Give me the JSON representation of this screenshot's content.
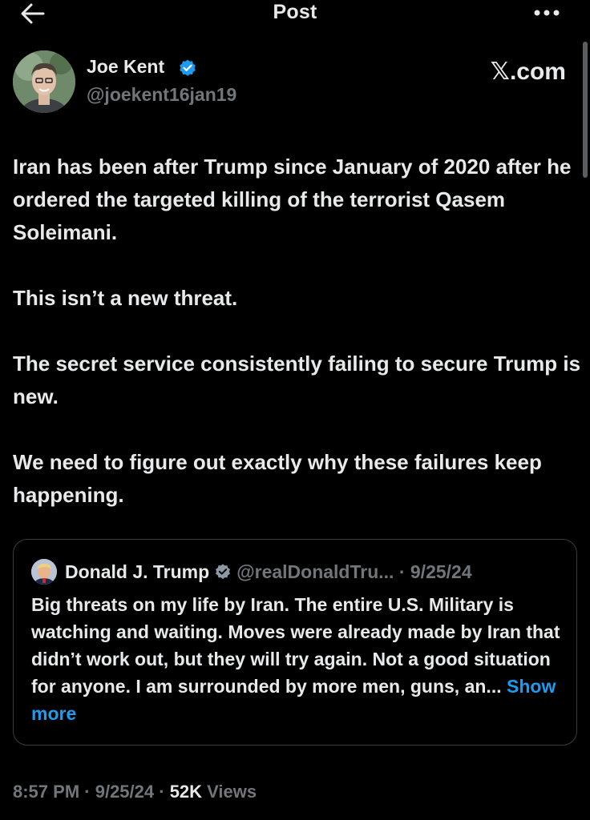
{
  "header": {
    "title": "Post",
    "back_icon": "arrow-left-icon",
    "more_icon": "more-horizontal-icon"
  },
  "author": {
    "name": "Joe Kent",
    "handle": "@joekent16jan19",
    "verified_icon": "verified-badge-icon",
    "source": "𝕏.com"
  },
  "post": {
    "paragraphs": [
      "Iran has been after Trump since January of 2020 after he ordered the targeted killing of the terrorist Qasem Soleimani.",
      "This isn’t a new threat.",
      "The secret service consistently failing to secure Trump is new.",
      "We need to figure out exactly why these failures keep happening."
    ]
  },
  "quote": {
    "name": "Donald J. Trump",
    "handle": "@realDonaldTru...",
    "separator": " · ",
    "date": "9/25/24",
    "text": "Big threats on my life by Iran. The entire U.S. Military is watching and waiting. Moves were already made by Iran that didn’t work out, but they will try again. Not a good situation for anyone. I am surrounded by more men, guns, an...",
    "show_more": "Show more"
  },
  "meta": {
    "time": "8:57 PM",
    "sep1": " · ",
    "date": "9/25/24",
    "sep2": " · ",
    "views_count": "52K",
    "views_label": " Views"
  },
  "colors": {
    "background": "#000000",
    "text_primary": "#e7e9ea",
    "text_secondary": "#71767b",
    "accent_blue": "#1d9bf0",
    "border": "#3a3d40"
  }
}
